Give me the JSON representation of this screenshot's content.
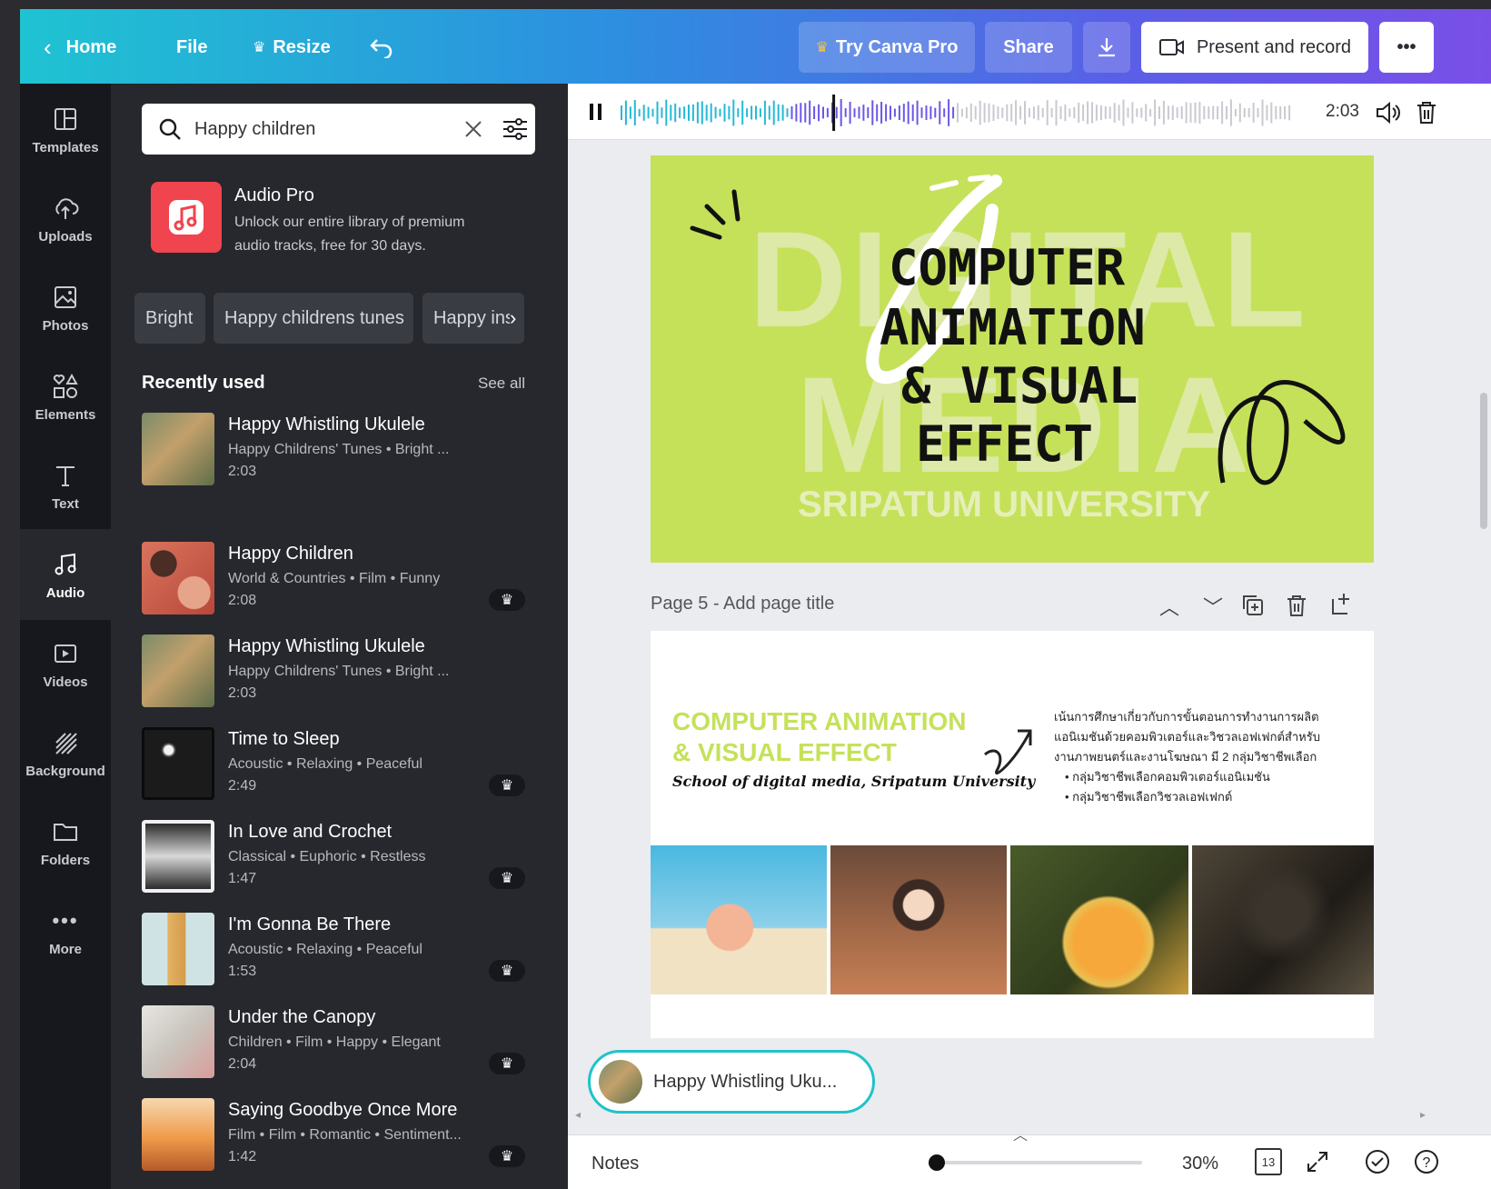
{
  "topbar": {
    "home": "Home",
    "file": "File",
    "resize": "Resize",
    "try_pro": "Try Canva Pro",
    "share": "Share",
    "present": "Present and record",
    "more": "•••"
  },
  "rail": [
    {
      "label": "Templates",
      "icon": "templates-icon"
    },
    {
      "label": "Uploads",
      "icon": "upload-icon"
    },
    {
      "label": "Photos",
      "icon": "photos-icon"
    },
    {
      "label": "Elements",
      "icon": "elements-icon"
    },
    {
      "label": "Text",
      "icon": "text-icon"
    },
    {
      "label": "Audio",
      "icon": "audio-icon"
    },
    {
      "label": "Videos",
      "icon": "videos-icon"
    },
    {
      "label": "Background",
      "icon": "background-icon"
    },
    {
      "label": "Folders",
      "icon": "folders-icon"
    },
    {
      "label": "More",
      "icon": "more-icon"
    }
  ],
  "panel": {
    "search_value": "Happy children",
    "promo_title": "Audio Pro",
    "promo_desc_1": "Unlock our entire library of premium",
    "promo_desc_2": "audio tracks, free for 30 days.",
    "chips": [
      "Bright",
      "Happy childrens tunes",
      "Happy ins"
    ],
    "recent_heading": "Recently used",
    "see_all": "See all",
    "tracks": [
      {
        "title": "Happy Whistling Ukulele",
        "tags": "Happy Childrens' Tunes • Bright ...",
        "duration": "2:03",
        "pro": false
      },
      {
        "title": "Happy Children",
        "tags": "World & Countries • Film • Funny",
        "duration": "2:08",
        "pro": true
      },
      {
        "title": "Happy Whistling Ukulele",
        "tags": "Happy Childrens' Tunes • Bright ...",
        "duration": "2:03",
        "pro": false
      },
      {
        "title": "Time to Sleep",
        "tags": "Acoustic • Relaxing • Peaceful",
        "duration": "2:49",
        "pro": true
      },
      {
        "title": "In Love and Crochet",
        "tags": "Classical • Euphoric • Restless",
        "duration": "1:47",
        "pro": true
      },
      {
        "title": "I'm Gonna Be There",
        "tags": "Acoustic • Relaxing • Peaceful",
        "duration": "1:53",
        "pro": true
      },
      {
        "title": "Under the Canopy",
        "tags": "Children • Film • Happy • Elegant",
        "duration": "2:04",
        "pro": true
      },
      {
        "title": "Saying Goodbye Once More",
        "tags": "Film • Film • Romantic • Sentiment...",
        "duration": "1:42",
        "pro": true
      }
    ]
  },
  "audiobar": {
    "duration": "2:03",
    "progress": 0.5
  },
  "page4": {
    "bg_word_1": "DIGITAL",
    "bg_word_2": "MEDIA",
    "title_1": "COMPUTER",
    "title_2": "ANIMATION",
    "title_3": "& VISUAL",
    "title_4": "EFFECT",
    "university": "SRIPATUM UNIVERSITY"
  },
  "page5": {
    "header": "Page 5 - Add page title",
    "title_1": "COMPUTER ANIMATION",
    "title_2": "& VISUAL EFFECT",
    "subtitle": "School of digital media, Sripatum University",
    "desc_1": "เน้นการศึกษาเกี่ยวกับการขั้นตอนการทำงานการผลิต",
    "desc_2": "แอนิเมชันด้วยคอมพิวเตอร์และวิชวลเอฟเฟกต์สำหรับ",
    "desc_3": "งานภาพยนตร์และงานโฆษณา มี 2 กลุ่มวิชาชีพเลือก",
    "bullet_1": "กลุ่มวิชาชีพเลือกคอมพิวเตอร์แอนิเมชัน",
    "bullet_2": "กลุ่มวิชาชีพเลือกวิชวลเอฟเฟกต์"
  },
  "now_playing": "Happy Whistling Uku...",
  "footer": {
    "notes": "Notes",
    "zoom": "30%",
    "zoom_level": 0.3,
    "page_count": "13"
  },
  "colors": {
    "accent_teal": "#1fc3d2",
    "accent_purple": "#7a4fe8",
    "slide_green": "#c5e15a",
    "pro_red": "#f0444e"
  }
}
